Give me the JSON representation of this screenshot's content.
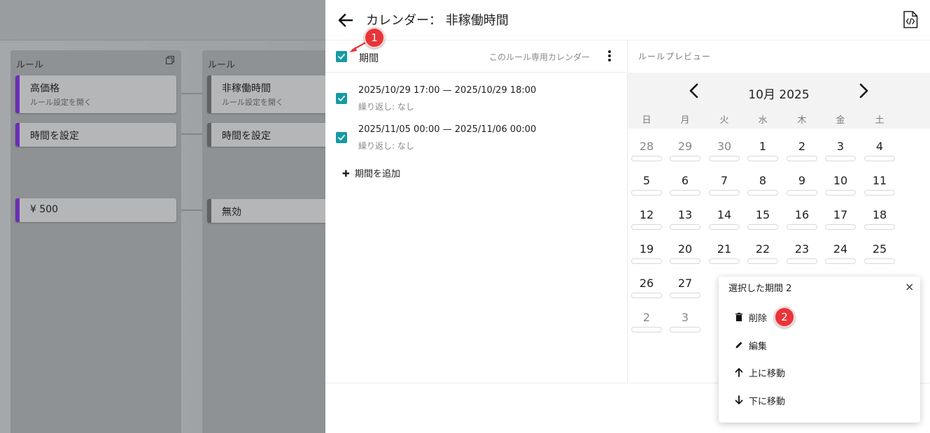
{
  "background": {
    "columns": [
      {
        "title": "ルール",
        "nodes": [
          {
            "label": "高価格",
            "sub": "ルール設定を開く"
          },
          {
            "label": "時間を設定"
          },
          {
            "label": "¥ 500"
          }
        ]
      },
      {
        "title": "ルール",
        "nodes": [
          {
            "label": "非稼働時間",
            "sub": "ルール設定を開く"
          },
          {
            "label": "時間を設定"
          },
          {
            "label": "無効"
          }
        ]
      }
    ]
  },
  "header": {
    "title": "カレンダー： 非稼働時間",
    "back_icon": "arrow-left-icon",
    "code_icon": "file-code-icon"
  },
  "list": {
    "header_label": "期間",
    "calendar_label": "このルール専用カレンダー",
    "periods": [
      {
        "range": "2025/10/29 17:00 — 2025/10/29 18:00",
        "repeat": "繰り返し: なし"
      },
      {
        "range": "2025/11/05 00:00 — 2025/11/06 00:00",
        "repeat": "繰り返し: なし"
      }
    ],
    "add_label": "期間を追加"
  },
  "preview": {
    "label": "ルールプレビュー",
    "month": "10月 2025",
    "weekdays": [
      "日",
      "月",
      "火",
      "水",
      "木",
      "金",
      "土"
    ],
    "weeks": [
      [
        "28",
        "29",
        "30",
        "1",
        "2",
        "3",
        "4"
      ],
      [
        "5",
        "6",
        "7",
        "8",
        "9",
        "10",
        "11"
      ],
      [
        "12",
        "13",
        "14",
        "15",
        "16",
        "17",
        "18"
      ],
      [
        "19",
        "20",
        "21",
        "22",
        "23",
        "24",
        "25"
      ],
      [
        "26",
        "27",
        "",
        "",
        "",
        "",
        ""
      ],
      [
        "2",
        "3",
        "",
        "",
        "",
        "",
        ""
      ]
    ]
  },
  "popup": {
    "title": "選択した期間 2",
    "close": "×",
    "items": [
      {
        "label": "削除",
        "icon": "trash-icon"
      },
      {
        "label": "編集",
        "icon": "pencil-icon"
      },
      {
        "label": "上に移動",
        "icon": "arrow-up-icon"
      },
      {
        "label": "下に移動",
        "icon": "arrow-down-icon"
      }
    ]
  },
  "badges": {
    "one": "1",
    "two": "2"
  },
  "colors": {
    "accent": "#159aa3",
    "node_purple": "#6b2fb3",
    "badge_red": "#e8353a"
  }
}
